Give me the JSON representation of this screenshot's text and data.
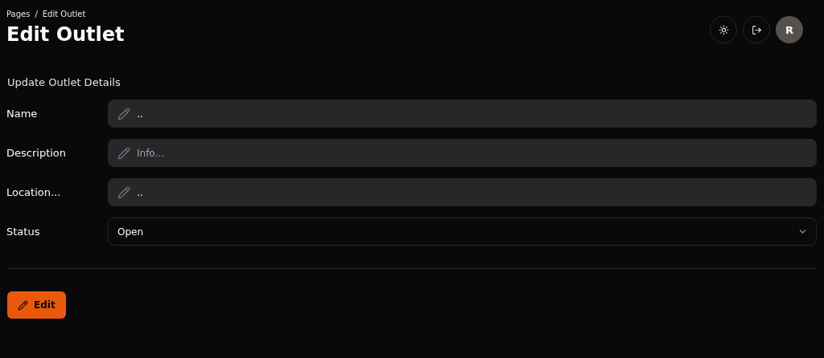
{
  "breadcrumb": {
    "items": [
      "Pages",
      "Edit Outlet"
    ],
    "separator": "/"
  },
  "title": "Edit Outlet",
  "header_actions": {
    "avatar": "R"
  },
  "form": {
    "heading": "Update Outlet Details",
    "fields": [
      {
        "kind": "text",
        "label": "Name",
        "value": ".."
      },
      {
        "kind": "text",
        "label": "Description",
        "placeholder": "Info..."
      },
      {
        "kind": "text",
        "label": "Location...",
        "value": ".."
      },
      {
        "kind": "select",
        "label": "Status",
        "value": "Open"
      }
    ],
    "submit": "Edit"
  }
}
